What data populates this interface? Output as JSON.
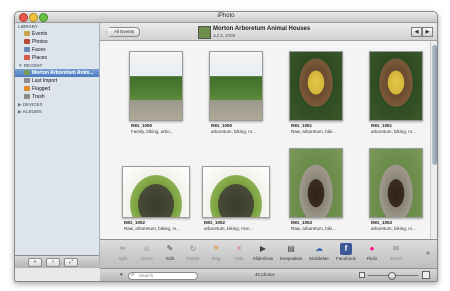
{
  "window": {
    "title": "iPhoto"
  },
  "sidebar": {
    "library_header": "LIBRARY",
    "library_items": [
      {
        "label": "Events",
        "icon": "events-icon",
        "color": "#c9a24a"
      },
      {
        "label": "Photos",
        "icon": "photos-icon",
        "color": "#b84a3a"
      },
      {
        "label": "Faces",
        "icon": "faces-icon",
        "color": "#6a88b8"
      },
      {
        "label": "Places",
        "icon": "places-icon",
        "color": "#d55a4a"
      }
    ],
    "recent_header": "RECENT",
    "recent_items": [
      {
        "label": "Morton Arboretum Anim...",
        "icon": "event-icon",
        "color": "#7a9a5a",
        "selected": true
      },
      {
        "label": "Last Import",
        "icon": "import-icon",
        "color": "#8a8a8a"
      },
      {
        "label": "Flagged",
        "icon": "flag-icon",
        "color": "#e08a2a"
      },
      {
        "label": "Trash",
        "icon": "trash-icon",
        "color": "#8a8a8a"
      }
    ],
    "devices_header": "DEVICES",
    "albums_header": "ALBUMS"
  },
  "topbar": {
    "back_label": "All Events",
    "event_title": "Morton Arboretum Animal Houses",
    "event_date": "Jul 3, 2009",
    "prev_glyph": "◀",
    "next_glyph": "▶"
  },
  "photos": [
    {
      "name": "IMG_1050",
      "keywords": "Family, biking, arbo...",
      "scene": "park"
    },
    {
      "name": "IMG_1050",
      "keywords": "arboretum, biking, m...",
      "scene": "park"
    },
    {
      "name": "IMG_1051",
      "keywords": "Raw, arboretum, biki...",
      "scene": "sign"
    },
    {
      "name": "IMG_1051",
      "keywords": "arboretum, biking, m...",
      "scene": "sign"
    },
    {
      "name": "IMG_1052",
      "keywords": "Raw, arboretum, biking, m...",
      "scene": "mound"
    },
    {
      "name": "IMG_1052",
      "keywords": "arboretum, biking, mor...",
      "scene": "mound"
    },
    {
      "name": "IMG_1053",
      "keywords": "Raw, arboretum, biki...",
      "scene": "arch"
    },
    {
      "name": "IMG_1053",
      "keywords": "arboretum, biking, m...",
      "scene": "arch"
    }
  ],
  "toolbar": {
    "tools": [
      {
        "label": "Split",
        "glyph": "✂",
        "enabled": false,
        "icon": "split-icon"
      },
      {
        "label": "Name",
        "glyph": "☺",
        "enabled": false,
        "icon": "name-icon"
      },
      {
        "label": "Edit",
        "glyph": "✎",
        "enabled": true,
        "icon": "edit-icon"
      },
      {
        "label": "Rotate",
        "glyph": "↻",
        "enabled": false,
        "icon": "rotate-icon"
      },
      {
        "label": "Flag",
        "glyph": "⚑",
        "enabled": false,
        "icon": "flag-icon"
      },
      {
        "label": "Hide",
        "glyph": "✕",
        "enabled": false,
        "icon": "hide-icon"
      },
      {
        "label": "Slideshow",
        "glyph": "▶",
        "enabled": true,
        "icon": "slideshow-icon"
      },
      {
        "label": "Keepsakes",
        "glyph": "▤",
        "enabled": true,
        "icon": "keepsakes-icon"
      },
      {
        "label": "MobileMe",
        "glyph": "☁",
        "enabled": true,
        "icon": "mobileme-icon"
      },
      {
        "label": "Facebook",
        "glyph": "f",
        "enabled": true,
        "icon": "facebook-icon"
      },
      {
        "label": "Flickr",
        "glyph": "●",
        "enabled": true,
        "icon": "flickr-icon"
      },
      {
        "label": "Email",
        "glyph": "✉",
        "enabled": false,
        "icon": "email-icon"
      }
    ],
    "overflow_glyph": "»"
  },
  "statusbar": {
    "search_placeholder": "Search",
    "photo_count": "40 photos",
    "zoom_level": 0.45
  },
  "bottom_buttons": {
    "add": "+",
    "info": "i",
    "fullscreen": "⤢"
  }
}
